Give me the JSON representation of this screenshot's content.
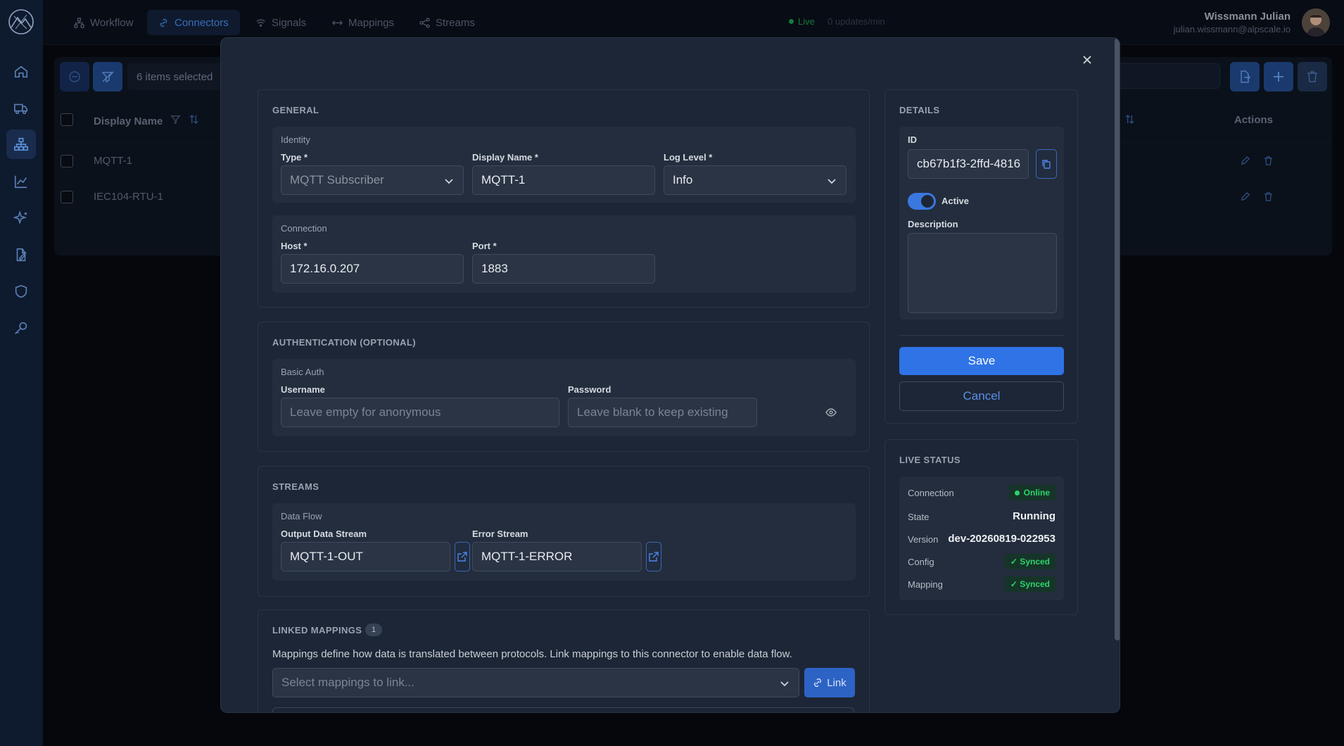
{
  "nav": {
    "tabs": [
      "Workflow",
      "Connectors",
      "Signals",
      "Mappings",
      "Streams"
    ],
    "live_label": "Live",
    "updates": "0 updates/min"
  },
  "user": {
    "name": "Wissmann Julian",
    "email": "julian.wissmann@alpscale.io"
  },
  "toolbar": {
    "selected": "6 items selected"
  },
  "table": {
    "headers": {
      "display_name": "Display Name",
      "actions": "Actions"
    },
    "rows": [
      "MQTT-1",
      "IEC104-RTU-1"
    ]
  },
  "modal": {
    "general": {
      "title": "GENERAL",
      "identity_label": "Identity",
      "type_label": "Type *",
      "type_value": "MQTT Subscriber",
      "display_name_label": "Display Name *",
      "display_name_value": "MQTT-1",
      "log_level_label": "Log Level *",
      "log_level_value": "Info",
      "connection_label": "Connection",
      "host_label": "Host *",
      "host_value": "172.16.0.207",
      "port_label": "Port *",
      "port_value": "1883"
    },
    "auth": {
      "title": "AUTHENTICATION (OPTIONAL)",
      "group_label": "Basic Auth",
      "username_label": "Username",
      "username_placeholder": "Leave empty for anonymous",
      "password_label": "Password",
      "password_placeholder": "Leave blank to keep existing"
    },
    "streams": {
      "title": "STREAMS",
      "group_label": "Data Flow",
      "output_label": "Output Data Stream",
      "output_value": "MQTT-1-OUT",
      "error_label": "Error Stream",
      "error_value": "MQTT-1-ERROR"
    },
    "linked": {
      "title": "LINKED MAPPINGS",
      "count": "1",
      "description": "Mappings define how data is translated between protocols. Link mappings to this connector to enable data flow.",
      "select_placeholder": "Select mappings to link...",
      "link_button": "Link"
    },
    "details": {
      "title": "DETAILS",
      "id_label": "ID",
      "id_value": "cb67b1f3-2ffd-4816",
      "active_label": "Active",
      "active": true,
      "description_label": "Description",
      "save": "Save",
      "cancel": "Cancel"
    },
    "live_status": {
      "title": "LIVE STATUS",
      "connection_label": "Connection",
      "connection_value": "Online",
      "state_label": "State",
      "state_value": "Running",
      "version_label": "Version",
      "version_value": "dev-20260819-022953",
      "config_label": "Config",
      "config_value": "✓ Synced",
      "mapping_label": "Mapping",
      "mapping_value": "✓ Synced"
    }
  },
  "colors": {
    "accent": "#2f73e6",
    "success": "#2fd36a",
    "modal_bg": "#1d2636"
  }
}
